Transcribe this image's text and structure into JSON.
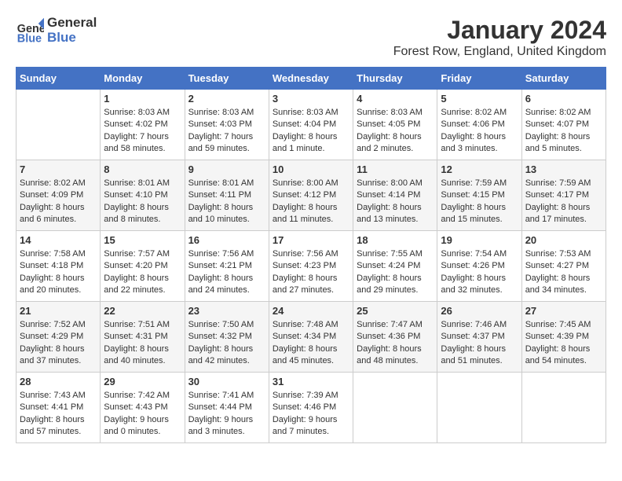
{
  "header": {
    "logo_general": "General",
    "logo_blue": "Blue",
    "month_title": "January 2024",
    "location": "Forest Row, England, United Kingdom"
  },
  "weekdays": [
    "Sunday",
    "Monday",
    "Tuesday",
    "Wednesday",
    "Thursday",
    "Friday",
    "Saturday"
  ],
  "weeks": [
    [
      {
        "day": "",
        "sunrise": "",
        "sunset": "",
        "daylight": ""
      },
      {
        "day": "1",
        "sunrise": "Sunrise: 8:03 AM",
        "sunset": "Sunset: 4:02 PM",
        "daylight": "Daylight: 7 hours and 58 minutes."
      },
      {
        "day": "2",
        "sunrise": "Sunrise: 8:03 AM",
        "sunset": "Sunset: 4:03 PM",
        "daylight": "Daylight: 7 hours and 59 minutes."
      },
      {
        "day": "3",
        "sunrise": "Sunrise: 8:03 AM",
        "sunset": "Sunset: 4:04 PM",
        "daylight": "Daylight: 8 hours and 1 minute."
      },
      {
        "day": "4",
        "sunrise": "Sunrise: 8:03 AM",
        "sunset": "Sunset: 4:05 PM",
        "daylight": "Daylight: 8 hours and 2 minutes."
      },
      {
        "day": "5",
        "sunrise": "Sunrise: 8:02 AM",
        "sunset": "Sunset: 4:06 PM",
        "daylight": "Daylight: 8 hours and 3 minutes."
      },
      {
        "day": "6",
        "sunrise": "Sunrise: 8:02 AM",
        "sunset": "Sunset: 4:07 PM",
        "daylight": "Daylight: 8 hours and 5 minutes."
      }
    ],
    [
      {
        "day": "7",
        "sunrise": "Sunrise: 8:02 AM",
        "sunset": "Sunset: 4:09 PM",
        "daylight": "Daylight: 8 hours and 6 minutes."
      },
      {
        "day": "8",
        "sunrise": "Sunrise: 8:01 AM",
        "sunset": "Sunset: 4:10 PM",
        "daylight": "Daylight: 8 hours and 8 minutes."
      },
      {
        "day": "9",
        "sunrise": "Sunrise: 8:01 AM",
        "sunset": "Sunset: 4:11 PM",
        "daylight": "Daylight: 8 hours and 10 minutes."
      },
      {
        "day": "10",
        "sunrise": "Sunrise: 8:00 AM",
        "sunset": "Sunset: 4:12 PM",
        "daylight": "Daylight: 8 hours and 11 minutes."
      },
      {
        "day": "11",
        "sunrise": "Sunrise: 8:00 AM",
        "sunset": "Sunset: 4:14 PM",
        "daylight": "Daylight: 8 hours and 13 minutes."
      },
      {
        "day": "12",
        "sunrise": "Sunrise: 7:59 AM",
        "sunset": "Sunset: 4:15 PM",
        "daylight": "Daylight: 8 hours and 15 minutes."
      },
      {
        "day": "13",
        "sunrise": "Sunrise: 7:59 AM",
        "sunset": "Sunset: 4:17 PM",
        "daylight": "Daylight: 8 hours and 17 minutes."
      }
    ],
    [
      {
        "day": "14",
        "sunrise": "Sunrise: 7:58 AM",
        "sunset": "Sunset: 4:18 PM",
        "daylight": "Daylight: 8 hours and 20 minutes."
      },
      {
        "day": "15",
        "sunrise": "Sunrise: 7:57 AM",
        "sunset": "Sunset: 4:20 PM",
        "daylight": "Daylight: 8 hours and 22 minutes."
      },
      {
        "day": "16",
        "sunrise": "Sunrise: 7:56 AM",
        "sunset": "Sunset: 4:21 PM",
        "daylight": "Daylight: 8 hours and 24 minutes."
      },
      {
        "day": "17",
        "sunrise": "Sunrise: 7:56 AM",
        "sunset": "Sunset: 4:23 PM",
        "daylight": "Daylight: 8 hours and 27 minutes."
      },
      {
        "day": "18",
        "sunrise": "Sunrise: 7:55 AM",
        "sunset": "Sunset: 4:24 PM",
        "daylight": "Daylight: 8 hours and 29 minutes."
      },
      {
        "day": "19",
        "sunrise": "Sunrise: 7:54 AM",
        "sunset": "Sunset: 4:26 PM",
        "daylight": "Daylight: 8 hours and 32 minutes."
      },
      {
        "day": "20",
        "sunrise": "Sunrise: 7:53 AM",
        "sunset": "Sunset: 4:27 PM",
        "daylight": "Daylight: 8 hours and 34 minutes."
      }
    ],
    [
      {
        "day": "21",
        "sunrise": "Sunrise: 7:52 AM",
        "sunset": "Sunset: 4:29 PM",
        "daylight": "Daylight: 8 hours and 37 minutes."
      },
      {
        "day": "22",
        "sunrise": "Sunrise: 7:51 AM",
        "sunset": "Sunset: 4:31 PM",
        "daylight": "Daylight: 8 hours and 40 minutes."
      },
      {
        "day": "23",
        "sunrise": "Sunrise: 7:50 AM",
        "sunset": "Sunset: 4:32 PM",
        "daylight": "Daylight: 8 hours and 42 minutes."
      },
      {
        "day": "24",
        "sunrise": "Sunrise: 7:48 AM",
        "sunset": "Sunset: 4:34 PM",
        "daylight": "Daylight: 8 hours and 45 minutes."
      },
      {
        "day": "25",
        "sunrise": "Sunrise: 7:47 AM",
        "sunset": "Sunset: 4:36 PM",
        "daylight": "Daylight: 8 hours and 48 minutes."
      },
      {
        "day": "26",
        "sunrise": "Sunrise: 7:46 AM",
        "sunset": "Sunset: 4:37 PM",
        "daylight": "Daylight: 8 hours and 51 minutes."
      },
      {
        "day": "27",
        "sunrise": "Sunrise: 7:45 AM",
        "sunset": "Sunset: 4:39 PM",
        "daylight": "Daylight: 8 hours and 54 minutes."
      }
    ],
    [
      {
        "day": "28",
        "sunrise": "Sunrise: 7:43 AM",
        "sunset": "Sunset: 4:41 PM",
        "daylight": "Daylight: 8 hours and 57 minutes."
      },
      {
        "day": "29",
        "sunrise": "Sunrise: 7:42 AM",
        "sunset": "Sunset: 4:43 PM",
        "daylight": "Daylight: 9 hours and 0 minutes."
      },
      {
        "day": "30",
        "sunrise": "Sunrise: 7:41 AM",
        "sunset": "Sunset: 4:44 PM",
        "daylight": "Daylight: 9 hours and 3 minutes."
      },
      {
        "day": "31",
        "sunrise": "Sunrise: 7:39 AM",
        "sunset": "Sunset: 4:46 PM",
        "daylight": "Daylight: 9 hours and 7 minutes."
      },
      {
        "day": "",
        "sunrise": "",
        "sunset": "",
        "daylight": ""
      },
      {
        "day": "",
        "sunrise": "",
        "sunset": "",
        "daylight": ""
      },
      {
        "day": "",
        "sunrise": "",
        "sunset": "",
        "daylight": ""
      }
    ]
  ]
}
